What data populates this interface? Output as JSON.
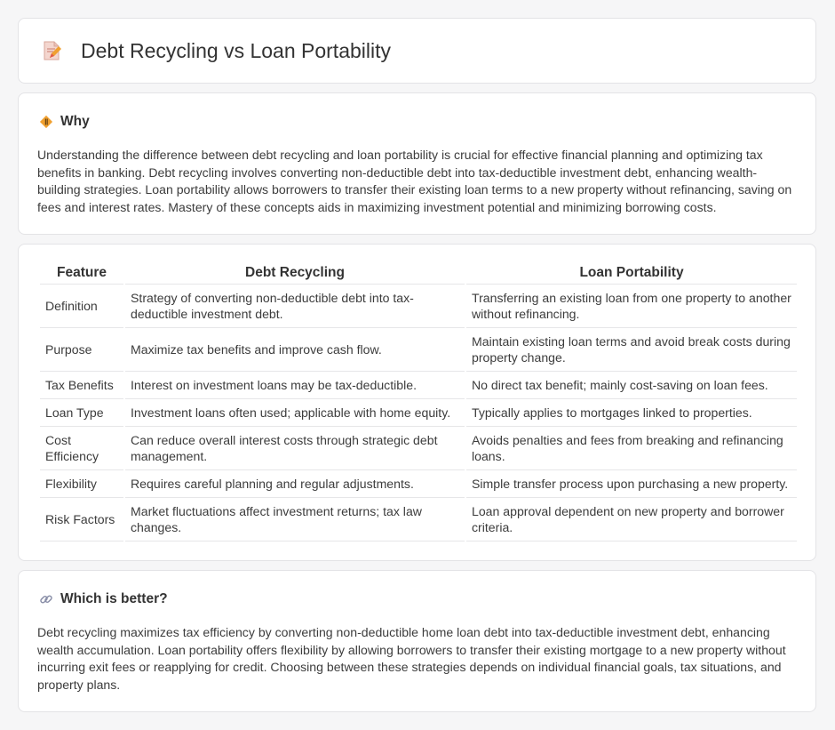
{
  "page": {
    "title": "Debt Recycling vs Loan Portability"
  },
  "why": {
    "heading": "Why",
    "body": "Understanding the difference between debt recycling and loan portability is crucial for effective financial planning and optimizing tax benefits in banking. Debt recycling involves converting non-deductible debt into tax-deductible investment debt, enhancing wealth-building strategies. Loan portability allows borrowers to transfer their existing loan terms to a new property without refinancing, saving on fees and interest rates. Mastery of these concepts aids in maximizing investment potential and minimizing borrowing costs."
  },
  "table": {
    "headers": [
      "Feature",
      "Debt Recycling",
      "Loan Portability"
    ],
    "rows": [
      [
        "Definition",
        "Strategy of converting non-deductible debt into tax-deductible investment debt.",
        "Transferring an existing loan from one property to another without refinancing."
      ],
      [
        "Purpose",
        "Maximize tax benefits and improve cash flow.",
        "Maintain existing loan terms and avoid break costs during property change."
      ],
      [
        "Tax Benefits",
        "Interest on investment loans may be tax-deductible.",
        "No direct tax benefit; mainly cost-saving on loan fees."
      ],
      [
        "Loan Type",
        "Investment loans often used; applicable with home equity.",
        "Typically applies to mortgages linked to properties."
      ],
      [
        "Cost Efficiency",
        "Can reduce overall interest costs through strategic debt management.",
        "Avoids penalties and fees from breaking and refinancing loans."
      ],
      [
        "Flexibility",
        "Requires careful planning and regular adjustments.",
        "Simple transfer process upon purchasing a new property."
      ],
      [
        "Risk Factors",
        "Market fluctuations affect investment returns; tax law changes.",
        "Loan approval dependent on new property and borrower criteria."
      ]
    ]
  },
  "better": {
    "heading": "Which is better?",
    "body": "Debt recycling maximizes tax efficiency by converting non-deductible home loan debt into tax-deductible investment debt, enhancing wealth accumulation. Loan portability offers flexibility by allowing borrowers to transfer their existing mortgage to a new property without incurring exit fees or reapplying for credit. Choosing between these strategies depends on individual financial goals, tax situations, and property plans."
  },
  "icons": {
    "title": "document-pencil-icon",
    "why": "diamond-sign-icon",
    "better": "link-icon"
  },
  "colors": {
    "accent_orange": "#f0a030",
    "accent_red": "#e05a4a"
  }
}
